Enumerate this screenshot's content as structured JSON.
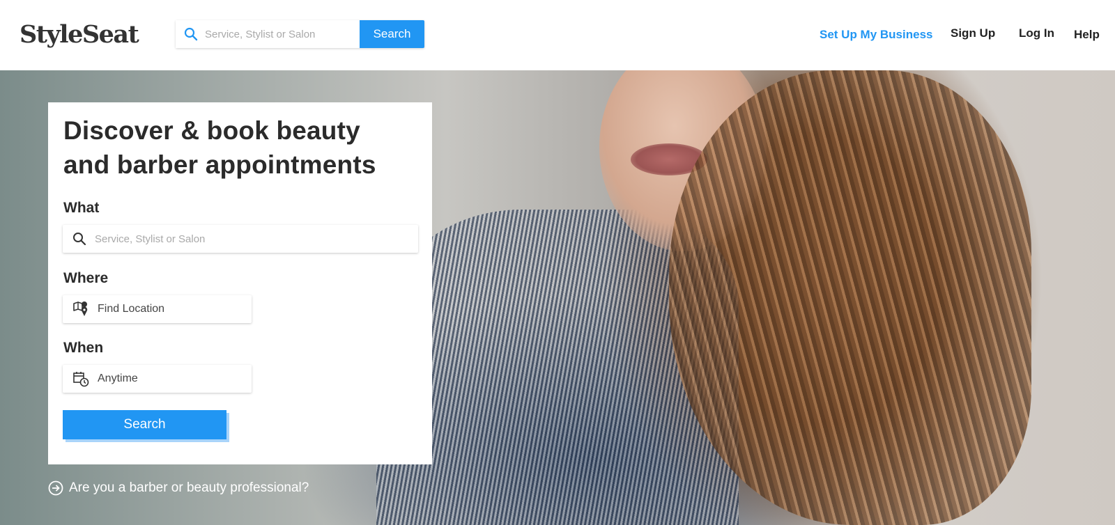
{
  "header": {
    "logo": "StyleSeat",
    "search": {
      "placeholder": "Service, Stylist or Salon",
      "button_label": "Search"
    },
    "nav": {
      "business": "Set Up My Business",
      "signup": "Sign Up",
      "login": "Log In",
      "help": "Help"
    }
  },
  "hero": {
    "headline": "Discover & book beauty and barber appointments",
    "what": {
      "label": "What",
      "placeholder": "Service, Stylist or Salon"
    },
    "where": {
      "label": "Where",
      "value": "Find Location"
    },
    "when": {
      "label": "When",
      "value": "Anytime"
    },
    "search_button": "Search",
    "pro_link": "Are you a barber or beauty professional?"
  },
  "icons": {
    "header_search": "search-icon",
    "what_search": "search-icon",
    "where": "map-pin-icon",
    "when": "calendar-clock-icon",
    "pro": "arrow-circle-icon"
  },
  "colors": {
    "accent": "#2196f3",
    "accent_shadow": "#a9d4fa",
    "text": "#2b2b2b"
  }
}
